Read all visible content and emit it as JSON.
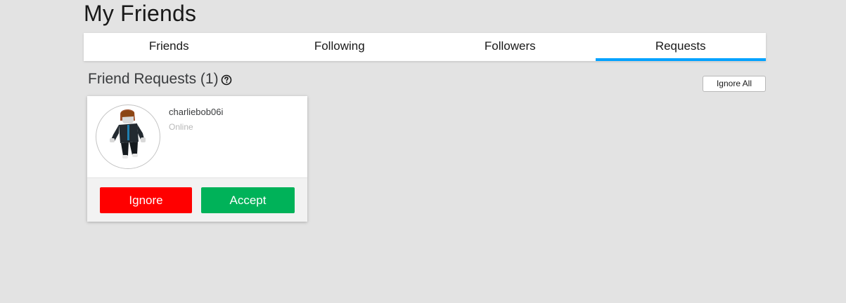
{
  "page_title": "My Friends",
  "tabs": [
    {
      "label": "Friends",
      "active": false
    },
    {
      "label": "Following",
      "active": false
    },
    {
      "label": "Followers",
      "active": false
    },
    {
      "label": "Requests",
      "active": true
    }
  ],
  "section": {
    "title": "Friend Requests (1)",
    "help_icon": "question-circle-icon",
    "ignore_all_label": "Ignore All"
  },
  "requests": [
    {
      "username": "charliebob06i",
      "status": "Online",
      "avatar_icon": "avatar-icon",
      "ignore_label": "Ignore",
      "accept_label": "Accept"
    }
  ],
  "colors": {
    "accent": "#00a2ff",
    "ignore": "#ff0000",
    "accept": "#00b259",
    "background": "#e3e3e3"
  }
}
